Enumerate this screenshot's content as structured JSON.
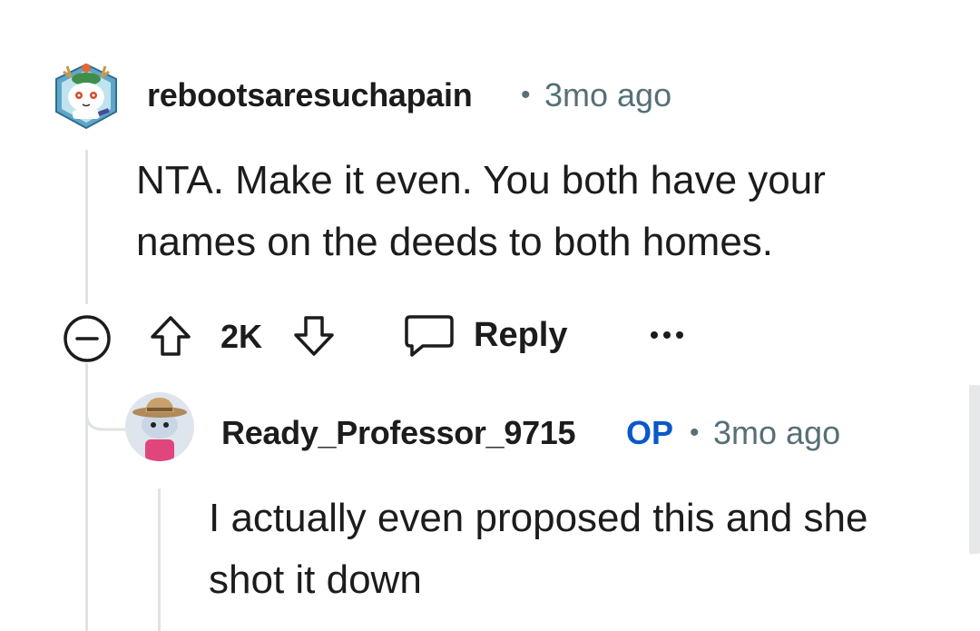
{
  "comment": {
    "username": "rebootsaresuchapain",
    "separator": "•",
    "time": "3mo ago",
    "body_line1": "NTA. Make it even. You both have your",
    "body_line2": "names on the deeds to both homes.",
    "actions": {
      "collapse_icon": "minus-circle-icon",
      "upvote_icon": "arrow-up-icon",
      "vote_count": "2K",
      "downvote_icon": "arrow-down-icon",
      "reply_icon": "speech-bubble-icon",
      "reply_label": "Reply",
      "more_icon": "ellipsis-icon"
    }
  },
  "reply": {
    "username": "Ready_Professor_9715",
    "op_badge": "OP",
    "separator": "•",
    "time": "3mo ago",
    "body_line1": "I actually even proposed this and she",
    "body_line2": "shot it down"
  },
  "colors": {
    "meta_gray": "#576f76",
    "op_blue": "#0a58ca",
    "thread_line": "#e0e3e5"
  }
}
